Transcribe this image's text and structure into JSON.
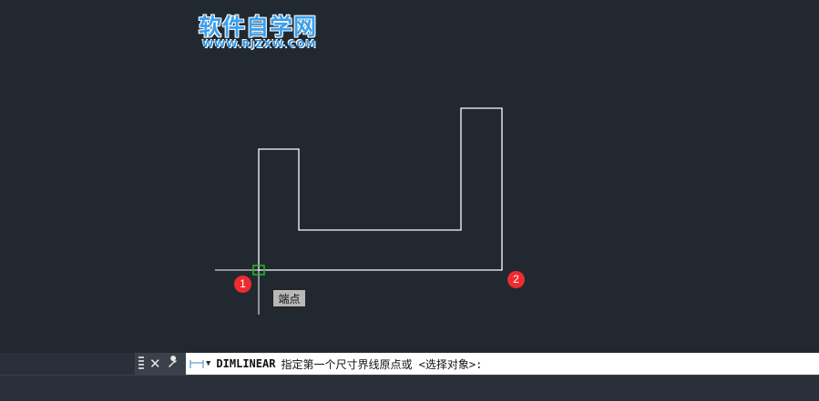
{
  "watermark": {
    "title": "软件自学网",
    "url": "WWW.RJZXW.COM"
  },
  "markers": {
    "first": "1",
    "second": "2"
  },
  "tooltip": {
    "label": "端点"
  },
  "command_line": {
    "command": "DIMLINEAR",
    "prompt": "指定第一个尺寸界线原点或 <选择对象>:"
  },
  "icons": {
    "grip": "drag-handle-icon",
    "close": "close-icon",
    "customize": "wrench-icon",
    "command": "dimlinear-icon"
  },
  "colors": {
    "background": "#212830",
    "geometry": "#ffffff",
    "snap_marker": "#1fbf1f",
    "point_marker": "#ee2c30"
  }
}
